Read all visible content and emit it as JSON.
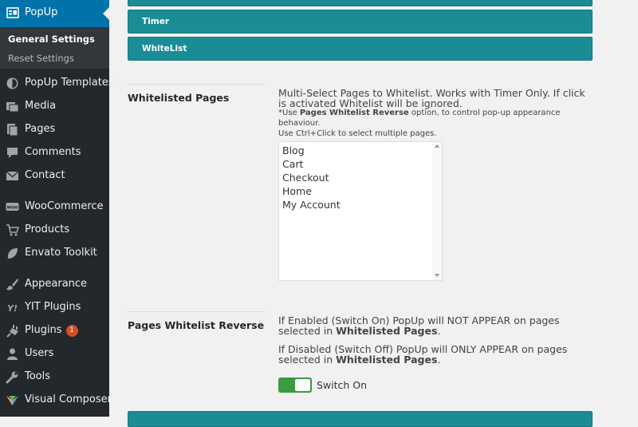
{
  "sidebar": {
    "active": {
      "label": "PopUp",
      "icon": "popup-icon"
    },
    "submenu": [
      {
        "label": "General Settings",
        "current": true
      },
      {
        "label": "Reset Settings",
        "current": false
      }
    ],
    "items": [
      {
        "label": "PopUp Templates",
        "icon": "template-icon"
      },
      {
        "label": "Media",
        "icon": "media-icon"
      },
      {
        "label": "Pages",
        "icon": "pages-icon"
      },
      {
        "label": "Comments",
        "icon": "comments-icon"
      },
      {
        "label": "Contact",
        "icon": "mail-icon"
      },
      {
        "label": "WooCommerce",
        "icon": "woocommerce-icon"
      },
      {
        "label": "Products",
        "icon": "cart-icon"
      },
      {
        "label": "Envato Toolkit",
        "icon": "leaf-icon"
      },
      {
        "label": "Appearance",
        "icon": "brush-icon"
      },
      {
        "label": "YIT Plugins",
        "icon": "yit-icon"
      },
      {
        "label": "Plugins",
        "icon": "plugin-icon",
        "badge": "1"
      },
      {
        "label": "Users",
        "icon": "users-icon"
      },
      {
        "label": "Tools",
        "icon": "wrench-icon"
      },
      {
        "label": "Visual Composer",
        "icon": "visual-composer-icon"
      }
    ]
  },
  "sections": {
    "timer": "Timer",
    "whitelist": "WhiteList"
  },
  "whitelisted_pages": {
    "label": "Whitelisted Pages",
    "desc": "Multi-Select Pages to Whitelist. Works with Timer Only. If click is activated Whitelist will be ignored.",
    "note_prefix": "*Use ",
    "note_bold": "Pages Whitelist Reverse",
    "note_suffix": " option, to control pop-up appearance behaviour.",
    "note_line2": "Use Ctrl+Click to select multiple pages.",
    "options": [
      "Blog",
      "Cart",
      "Checkout",
      "Home",
      "My Account"
    ]
  },
  "reverse": {
    "label": "Pages Whitelist Reverse",
    "enabled_text": "If Enabled (Switch On) PopUp will NOT APPEAR on pages selected in ",
    "enabled_bold": "Whitelisted Pages",
    "disabled_text": "If Disabled (Switch Off) PopUp will ONLY APPEAR on pages selected in ",
    "disabled_bold": "Whitelisted Pages",
    "period": ".",
    "toggle_label": "Switch On",
    "toggle_on": true
  },
  "colors": {
    "accent": "#1a8c95",
    "admin_active": "#0073aa",
    "admin_bg": "#23282d",
    "toggle_on": "#3c9a3f"
  }
}
